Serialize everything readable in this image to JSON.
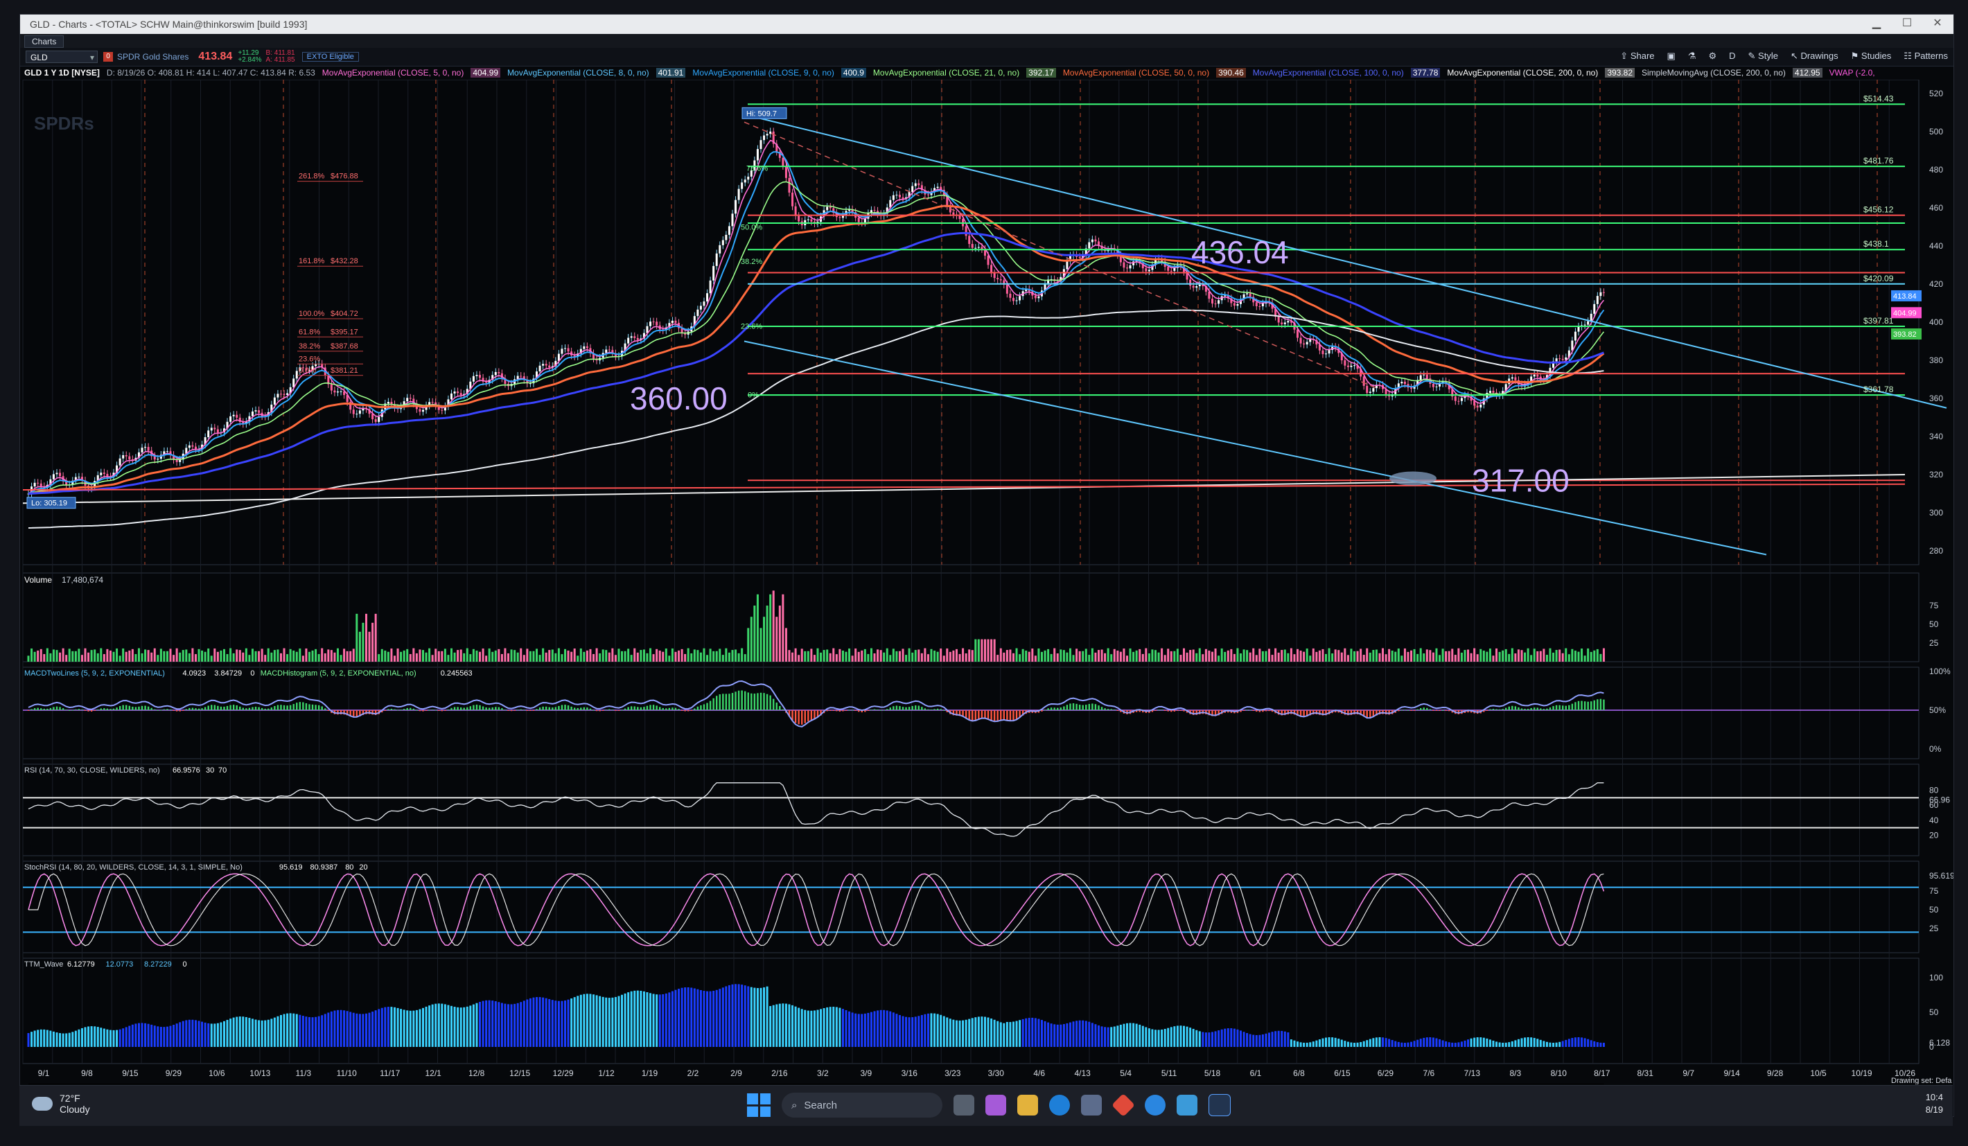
{
  "window": {
    "title": "GLD - Charts - <TOTAL> SCHW Main@thinkorswim [build 1993]",
    "tab": "Charts"
  },
  "toolbar": {
    "symbol": "GLD",
    "symbol_badge": "0",
    "description": "SPDR Gold Shares",
    "last_price": "413.84",
    "net_change": "+11.29",
    "pct_change": "+2.84%",
    "bid": "B: 411.81",
    "ask": "A: 411.85",
    "ext_label": "EXTO Eligible",
    "share": "Share",
    "style": "Style",
    "drawings": "Drawings",
    "studies": "Studies",
    "patterns": "Patterns",
    "flag": "D"
  },
  "studybar": {
    "header": "GLD 1 Y 1D [NYSE]",
    "ohlc": "D: 8/19/26   O: 408.81   H: 414   L: 407.47   C: 413.84   R: 6.53",
    "studies": [
      {
        "label": "MovAvgExponential (CLOSE, 5, 0, no)",
        "value": "404.99",
        "color": "#ff6fd8"
      },
      {
        "label": "MovAvgExponential (CLOSE, 8, 0, no)",
        "value": "401.91",
        "color": "#5fc8ff"
      },
      {
        "label": "MovAvgExponential (CLOSE, 9, 0, no)",
        "value": "400.9",
        "color": "#2fa8ff"
      },
      {
        "label": "MovAvgExponential (CLOSE, 21, 0, no)",
        "value": "392.17",
        "color": "#9cff8c"
      },
      {
        "label": "MovAvgExponential (CLOSE, 50, 0, no)",
        "value": "390.46",
        "color": "#ff6b3d"
      },
      {
        "label": "MovAvgExponential (CLOSE, 100, 0, no)",
        "value": "377.78",
        "color": "#5566ff"
      },
      {
        "label": "MovAvgExponential (CLOSE, 200, 0, no)",
        "value": "393.82",
        "color": "#ffffff"
      },
      {
        "label": "SimpleMovingAvg (CLOSE, 200, 0, no)",
        "value": "412.95",
        "color": "#d0d6e0"
      },
      {
        "label": "VWAP (-2.0,",
        "value": "",
        "color": "#ff5ce1"
      }
    ]
  },
  "panes": {
    "price": {
      "watermark": "SPDRs",
      "high_label": "Hi: 509.7",
      "low_label": "Lo: 305.19",
      "big_labels": [
        "436.04",
        "360.00",
        "317.00"
      ],
      "fib_labels": [
        {
          "text": "261.8%",
          "value": "$476.88"
        },
        {
          "text": "161.8%",
          "value": "$432.28"
        },
        {
          "text": "100.0%",
          "value": "$404.72"
        },
        {
          "text": "61.8%",
          "value": "$395.17"
        },
        {
          "text": "38.2%",
          "value": "$387.68"
        },
        {
          "text": "23.6%",
          "value": ""
        },
        {
          "text": "0.0%",
          "value": "$381.21"
        }
      ],
      "fib2_labels": [
        "78.6%",
        "50.0%",
        "38.2%",
        "23.6%",
        "0%"
      ],
      "level_labels": [
        "$514.43",
        "$481.76",
        "$456.12",
        "$438.1",
        "$420.09",
        "$397.81",
        "$361.78"
      ],
      "price_badges": [
        "413.84",
        "404.99",
        "393.82"
      ],
      "axis_ticks": [
        "520",
        "500",
        "480",
        "460",
        "440",
        "420",
        "400",
        "380",
        "360",
        "340",
        "320",
        "300",
        "280"
      ]
    },
    "volume": {
      "label": "Volume",
      "value": "17,480,674",
      "axis_ticks": [
        "75",
        "50",
        "25"
      ]
    },
    "macd": {
      "label": "MACDTwoLines (5, 9, 2, EXPONENTIAL)",
      "value1": "4.0923",
      "value2": "3.84729",
      "value3": "0",
      "hist_label": "MACDHistogram (5, 9, 2, EXPONENTIAL, no)",
      "hist_value": "0.245563",
      "axis_ticks": [
        "100%",
        "50%",
        "0%"
      ]
    },
    "rsi": {
      "label": "RSI (14, 70, 30, CLOSE, WILDERS, no)",
      "value": "66.9576",
      "ob": "30",
      "os": "70",
      "axis_ticks": [
        "80",
        "66.96",
        "60",
        "40",
        "20"
      ]
    },
    "stochrsi": {
      "label": "StochRSI (14, 80, 20, WILDERS, CLOSE, 14, 3, 1, SIMPLE, No)",
      "value": "95.619",
      "value2": "80.9387",
      "value3": "80",
      "value4": "20",
      "axis_ticks": [
        "95.619",
        "75",
        "50",
        "25"
      ]
    },
    "ttm": {
      "label": "TTM_Wave",
      "value": "6.12779",
      "value2": "12.0773",
      "value3": "8.27229",
      "value4": "0",
      "axis_ticks": [
        "100",
        "50",
        "6.128",
        "0"
      ]
    }
  },
  "xaxis": [
    "9/1",
    "9/8",
    "9/15",
    "9/29",
    "10/6",
    "10/13",
    "11/3",
    "11/10",
    "11/17",
    "12/1",
    "12/8",
    "12/15",
    "12/29",
    "1/12",
    "1/19",
    "2/2",
    "2/9",
    "2/16",
    "3/2",
    "3/9",
    "3/16",
    "3/23",
    "3/30",
    "4/6",
    "4/13",
    "5/4",
    "5/11",
    "5/18",
    "6/1",
    "6/8",
    "6/15",
    "6/29",
    "7/6",
    "7/13",
    "8/3",
    "8/10",
    "8/17",
    "8/31",
    "9/7",
    "9/14",
    "9/28",
    "10/5",
    "10/19",
    "10/26"
  ],
  "drawing_set": "Drawing set: Defa",
  "taskbar": {
    "temp": "72°F",
    "weather": "Cloudy",
    "search": "Search",
    "time": "10:4",
    "date": "8/19"
  }
}
